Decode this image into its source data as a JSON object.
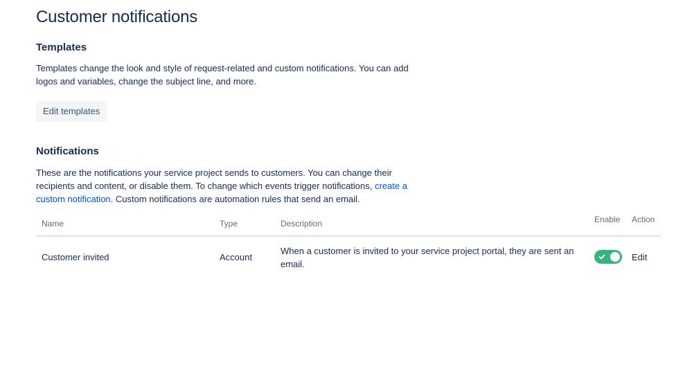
{
  "page": {
    "title": "Customer notifications"
  },
  "templates": {
    "heading": "Templates",
    "description": "Templates change the look and style of request-related and custom notifications. You can add logos and variables, change the subject line, and more.",
    "edit_button_label": "Edit templates"
  },
  "notifications": {
    "heading": "Notifications",
    "description_before_link": "These are the notifications your service project sends to customers. You can change their recipients and content, or disable them. To change which events trigger notifications, ",
    "description_link": "create a custom notification",
    "description_after_link": ". Custom notifications are automation rules that send an email.",
    "table": {
      "columns": {
        "name": "Name",
        "type": "Type",
        "description": "Description",
        "enable": "Enable",
        "action": "Action"
      },
      "rows": [
        {
          "name": "Customer invited",
          "type": "Account",
          "description": "When a customer is invited to your service project portal, they are sent an email.",
          "enabled": true,
          "action_label": "Edit"
        }
      ]
    }
  },
  "colors": {
    "toggle_on": "#36b37e",
    "link": "#0052cc",
    "text": "#172b4d"
  },
  "icons": {
    "toggle_check": "check-icon"
  }
}
